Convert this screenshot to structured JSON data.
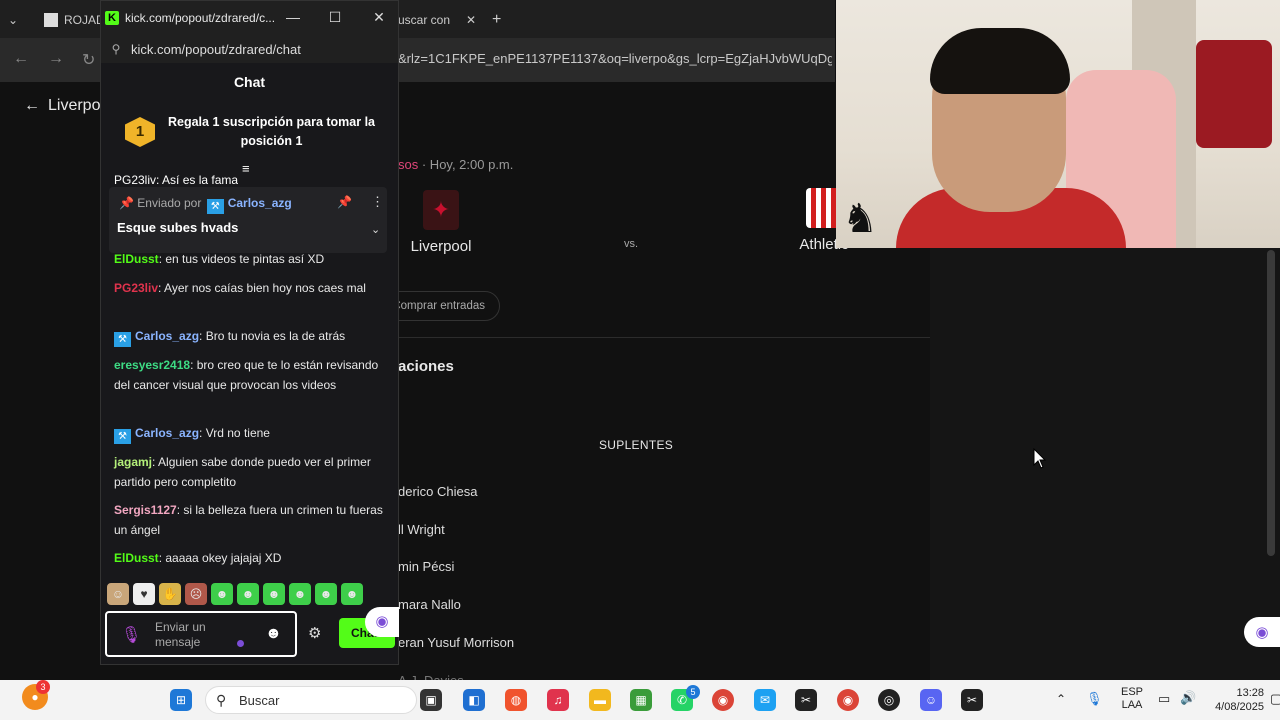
{
  "bg_browser": {
    "tabs": [
      {
        "label": "ROJAD"
      },
      {
        "label": "uscar con"
      }
    ],
    "new_tab": "+",
    "url_tail": "&rlz=1C1FKPE_enPE1137PE1137&oq=liverpo&gs_lcrp=EgZjaHJvbWUqDgg"
  },
  "page": {
    "back_label": "Liverpo",
    "match_competition": "sos",
    "match_time": "· Hoy, 2:00 p.m.",
    "home_team": "Liverpool",
    "away_team": "Athletic",
    "vs": "vs.",
    "buy_tickets": "Comprar entradas",
    "lineups_title": "aciones",
    "subs_heading": "SUPLENTES",
    "players": [
      "derico Chiesa",
      "ll Wright",
      "min Pécsi",
      "mara Nallo",
      "eran Yusuf Morrison",
      "A.J. Davies"
    ]
  },
  "popup": {
    "title": "kick.com/popout/zdrared/c...",
    "url": "kick.com/popout/zdrared/chat",
    "chat_header": "Chat",
    "gift": {
      "badge": "1",
      "text": "Regala 1 suscripción para tomar la posición 1"
    },
    "cut_message": "PG23liv: Así es la fama",
    "pinned": {
      "sent_by": "Enviado por",
      "user": "Carlos_azg",
      "message": "Esque subes hvads"
    },
    "messages": [
      {
        "user": "ElDusst",
        "color": "#53fc18",
        "badge": false,
        "text": ": en tus videos te pintas así XD"
      },
      {
        "user": "PG23liv",
        "color": "#e0334d",
        "badge": false,
        "text": ": Ayer nos caías bien hoy nos caes mal"
      },
      {
        "user": "Carlos_azg",
        "color": "#8ab4ff",
        "badge": true,
        "text": ": Bro tu novia es la de atrás"
      },
      {
        "user": "eresyesr2418",
        "color": "#3ddc84",
        "badge": false,
        "text": ": bro creo que te lo están revisando del cancer visual que provocan los videos"
      },
      {
        "user": "Carlos_azg",
        "color": "#8ab4ff",
        "badge": true,
        "text": ": Vrd no tiene"
      },
      {
        "user": "jagamj",
        "color": "#b4f07a",
        "badge": false,
        "text": ": Alguien sabe donde puedo ver el primer partido pero completito"
      },
      {
        "user": "Sergis1127",
        "color": "#f2a7c1",
        "badge": false,
        "text": ": si la belleza fuera un crimen tu fueras un ángel"
      },
      {
        "user": "ElDusst",
        "color": "#53fc18",
        "badge": false,
        "text": ": aaaaa okey jajajaj XD"
      }
    ],
    "input_placeholder": "Enviar un mensaje",
    "send_label": "Chat"
  },
  "taskbar": {
    "notif_count": "3",
    "search_label": "Buscar",
    "whatsapp_count": "5",
    "lang_top": "ESP",
    "lang_bottom": "LAA",
    "time": "13:28",
    "date": "4/08/2025"
  }
}
